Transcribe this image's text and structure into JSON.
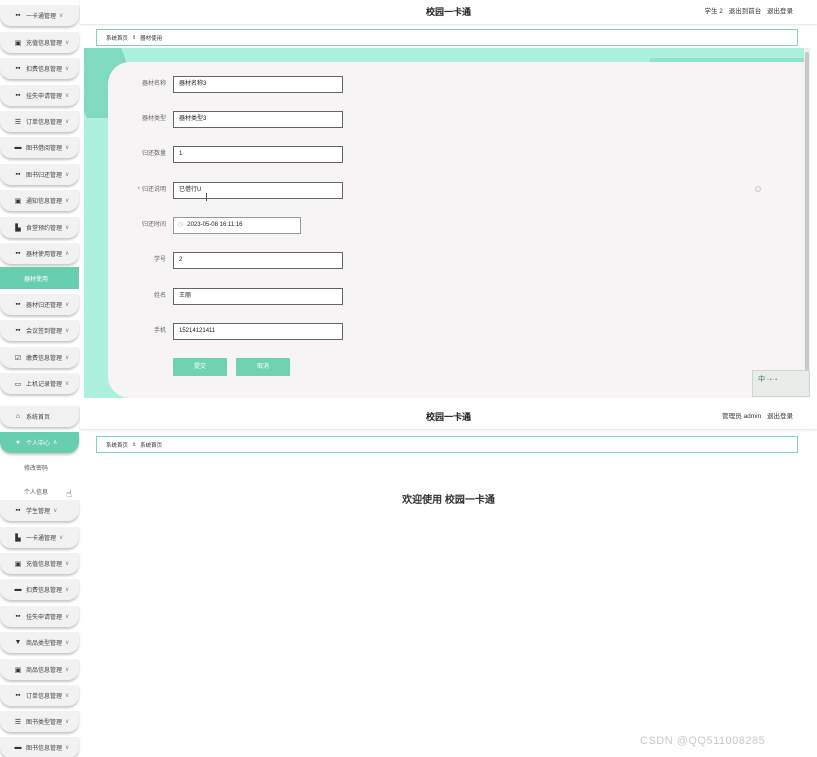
{
  "top": {
    "sidebar": {
      "items": [
        {
          "label": "一卡通管理",
          "icon": "grid-icon"
        },
        {
          "label": "充值信息管理",
          "icon": "doc-icon"
        },
        {
          "label": "扣费信息管理",
          "icon": "grid-icon"
        },
        {
          "label": "挂失申请管理",
          "icon": "grid-icon"
        },
        {
          "label": "订单信息管理",
          "icon": "list-icon"
        },
        {
          "label": "图书借阅管理",
          "icon": "book-icon"
        },
        {
          "label": "图书归还管理",
          "icon": "grid-icon"
        },
        {
          "label": "通知信息管理",
          "icon": "doc-icon"
        },
        {
          "label": "食堂预约管理",
          "icon": "chart-icon"
        },
        {
          "label": "器材使用管理",
          "icon": "grid-icon"
        },
        {
          "label": "器材归还管理",
          "icon": "grid-icon"
        },
        {
          "label": "会议签到管理",
          "icon": "grid-icon"
        },
        {
          "label": "缴费信息管理",
          "icon": "check-icon"
        },
        {
          "label": "上机记录管理",
          "icon": "monitor-icon"
        }
      ],
      "active_sub": "器材使用"
    },
    "header": {
      "title": "校园一卡通",
      "user": "学生 2",
      "back_front": "退出到前台",
      "logout": "退出登录"
    },
    "breadcrumb": {
      "home": "系统首页",
      "sep": "⁝",
      "current": "器材使用"
    },
    "form": {
      "fields": [
        {
          "label": "器材名称",
          "value": "器材名称3",
          "required": false
        },
        {
          "label": "器材类型",
          "value": "器材类型3",
          "required": false
        },
        {
          "label": "归还数量",
          "value": "1",
          "required": false
        },
        {
          "label": "归还说明",
          "value": "已借行U",
          "required": true
        },
        {
          "label": "归还时间",
          "value": "2023-05-08 16:11:16",
          "required": false
        },
        {
          "label": "学号",
          "value": "2",
          "required": false
        },
        {
          "label": "姓名",
          "value": "王丽",
          "required": false
        },
        {
          "label": "手机",
          "value": "15214121411",
          "required": false
        }
      ],
      "submit": "提交",
      "cancel": "取消"
    },
    "ime": {
      "label": "中"
    }
  },
  "bottom": {
    "sidebar": {
      "home": "系统首页",
      "personal": "个人中心",
      "sub_items": [
        "修改密码",
        "个人信息"
      ],
      "items": [
        {
          "label": "学生管理",
          "icon": "grid-icon"
        },
        {
          "label": "一卡通管理",
          "icon": "chart-icon"
        },
        {
          "label": "充值信息管理",
          "icon": "doc-icon"
        },
        {
          "label": "扣费信息管理",
          "icon": "grid-icon"
        },
        {
          "label": "挂失申请管理",
          "icon": "grid-icon"
        },
        {
          "label": "商品类型管理",
          "icon": "cup-icon"
        },
        {
          "label": "商品信息管理",
          "icon": "doc-icon"
        },
        {
          "label": "订单信息管理",
          "icon": "grid-icon"
        },
        {
          "label": "图书类型管理",
          "icon": "list-icon"
        },
        {
          "label": "图书信息管理",
          "icon": "book-icon"
        }
      ]
    },
    "header": {
      "title": "校园一卡通",
      "user": "管理员 admin",
      "logout": "退出登录"
    },
    "breadcrumb": {
      "home": "系统首页",
      "sep": "⁝",
      "current": "系统首页"
    },
    "welcome": "欢迎使用 校园一卡通"
  },
  "watermark": "CSDN @QQ511008285",
  "accent_color": "#68cfae"
}
